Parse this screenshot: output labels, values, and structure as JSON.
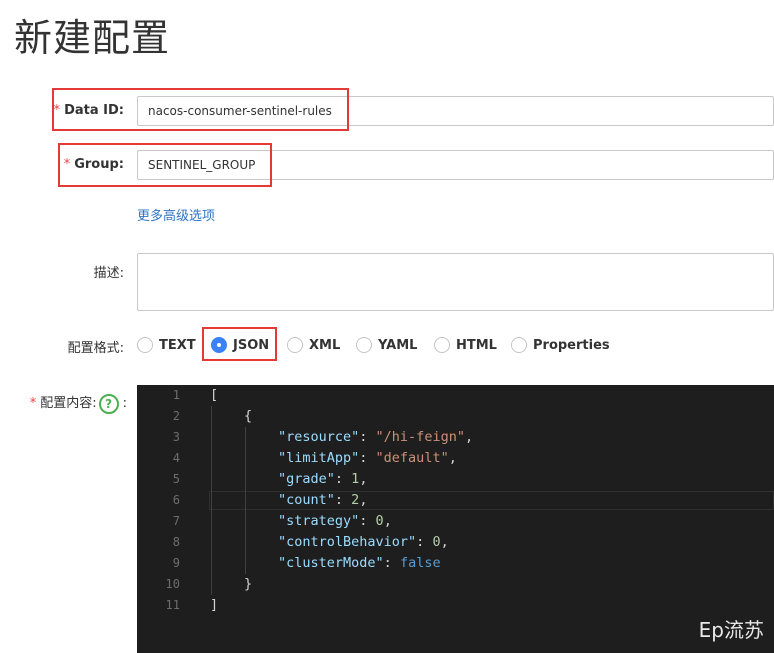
{
  "page": {
    "title": "新建配置"
  },
  "form": {
    "data_id": {
      "label": "Data ID:",
      "value": "nacos-consumer-sentinel-rules"
    },
    "group": {
      "label": "Group:",
      "value": "SENTINEL_GROUP"
    },
    "advanced_link": "更多高级选项",
    "description": {
      "label": "描述:",
      "value": ""
    },
    "format": {
      "label": "配置格式:",
      "options": [
        "TEXT",
        "JSON",
        "XML",
        "YAML",
        "HTML",
        "Properties"
      ],
      "selected": "JSON"
    },
    "content": {
      "label": "配置内容:",
      "help_glyph": "?",
      "colon": ":"
    }
  },
  "editor": {
    "line_numbers": [
      "1",
      "2",
      "3",
      "4",
      "5",
      "6",
      "7",
      "8",
      "9",
      "10",
      "11"
    ],
    "lines": [
      "[",
      "{",
      "\"resource\": \"/hi-feign\",",
      "\"limitApp\": \"default\",",
      "\"grade\": 1,",
      "\"count\": 2,",
      "\"strategy\": 0,",
      "\"controlBehavior\": 0,",
      "\"clusterMode\": false",
      "}",
      "]"
    ]
  },
  "watermark": "Ep流苏",
  "colors": {
    "required_star": "#e64545",
    "highlight_box": "#e53935",
    "link": "#2f74c4",
    "radio_checked": "#3b82f6",
    "help_icon": "#4caf50",
    "editor_bg": "#1e1e1e",
    "json_key": "#9cdcfe",
    "json_string": "#ce9178",
    "json_number": "#b5cea8",
    "json_boolean": "#569cd6"
  },
  "icons": {
    "help": "question-circle-icon",
    "required": "asterisk-icon"
  }
}
